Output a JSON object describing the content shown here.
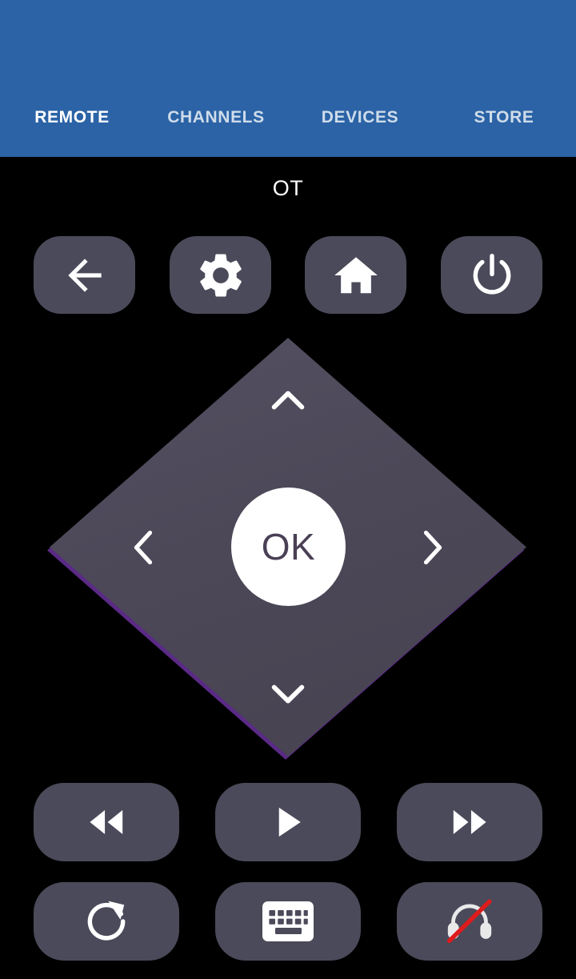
{
  "app": {
    "accent_color": "#2b63a6",
    "background_color": "#000000",
    "button_color": "#4b4a5a",
    "dpad_color": "#4c4858",
    "dpad_edge_color": "#5a2a86",
    "ok_text_color": "#4a4055",
    "slash_color": "#e01b1b"
  },
  "header": {
    "tabs": [
      {
        "label": "REMOTE",
        "active": true,
        "icon": "tab-remote"
      },
      {
        "label": "CHANNELS",
        "active": false,
        "icon": "tab-channels"
      },
      {
        "label": "DEVICES",
        "active": false,
        "icon": "tab-devices"
      },
      {
        "label": "STORE",
        "active": false,
        "icon": "tab-store"
      }
    ]
  },
  "remote": {
    "device_name": "OT",
    "top_row": [
      {
        "name": "back",
        "icon": "back-arrow-icon",
        "label": "Back"
      },
      {
        "name": "settings",
        "icon": "gear-icon",
        "label": "Settings"
      },
      {
        "name": "home",
        "icon": "home-icon",
        "label": "Home"
      },
      {
        "name": "power",
        "icon": "power-icon",
        "label": "Power"
      }
    ],
    "dpad": {
      "up": {
        "icon": "chevron-up-icon",
        "label": "Up"
      },
      "down": {
        "icon": "chevron-down-icon",
        "label": "Down"
      },
      "left": {
        "icon": "chevron-left-icon",
        "label": "Left"
      },
      "right": {
        "icon": "chevron-right-icon",
        "label": "Right"
      },
      "ok_label": "OK"
    },
    "transport_row": [
      {
        "name": "rewind",
        "icon": "rewind-icon",
        "label": "Rewind"
      },
      {
        "name": "play",
        "icon": "play-icon",
        "label": "Play"
      },
      {
        "name": "fast-forward",
        "icon": "fast-forward-icon",
        "label": "Fast forward"
      }
    ],
    "bottom_row": [
      {
        "name": "refresh",
        "icon": "refresh-icon",
        "label": "Refresh"
      },
      {
        "name": "keyboard",
        "icon": "keyboard-icon",
        "label": "Keyboard"
      },
      {
        "name": "headphones-off",
        "icon": "headphones-off-icon",
        "label": "Private listening off"
      }
    ]
  }
}
